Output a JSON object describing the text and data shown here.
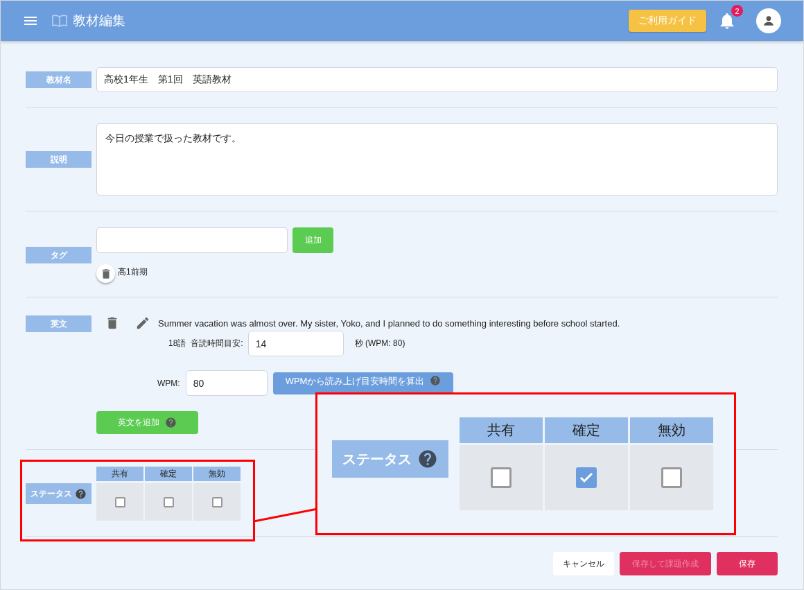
{
  "header": {
    "title": "教材編集",
    "guide_button": "ご利用ガイド",
    "notification_count": "2"
  },
  "title_field": {
    "label": "教材名",
    "value": "高校1年生　第1回　英語教材"
  },
  "description_field": {
    "label": "説明",
    "value": "今日の授業で扱った教材です。"
  },
  "tags_field": {
    "label": "タグ",
    "add_button": "追加",
    "tags": [
      "高1前期"
    ]
  },
  "sentences_field": {
    "label": "英文",
    "sentences": [
      {
        "text": "Summer vacation was almost over. My sister, Yoko, and I planned to do something interesting before school started.",
        "word_count": "18語",
        "time_label": "音読時間目安:",
        "time_value": "14",
        "unit": "秒 (WPM: 80)"
      }
    ],
    "wpm_label": "WPM:",
    "wpm_value": "80",
    "calc_button": "WPMから読み上げ目安時間を算出",
    "add_button": "英文を追加"
  },
  "status_field": {
    "label": "ステータス",
    "options": [
      {
        "label": "共有",
        "checked": false
      },
      {
        "label": "確定",
        "checked": false
      },
      {
        "label": "無効",
        "checked": false
      }
    ]
  },
  "callout": {
    "label": "ステータス",
    "options": [
      {
        "label": "共有",
        "checked": false
      },
      {
        "label": "確定",
        "checked": true
      },
      {
        "label": "無効",
        "checked": false
      }
    ]
  },
  "footer": {
    "buttons": [
      {
        "label": "キャンセル",
        "kind": "cancel",
        "disabled": false
      },
      {
        "label": "保存して課題作成",
        "kind": "primary",
        "disabled": true
      },
      {
        "label": "保存",
        "kind": "primary",
        "disabled": false
      }
    ]
  }
}
